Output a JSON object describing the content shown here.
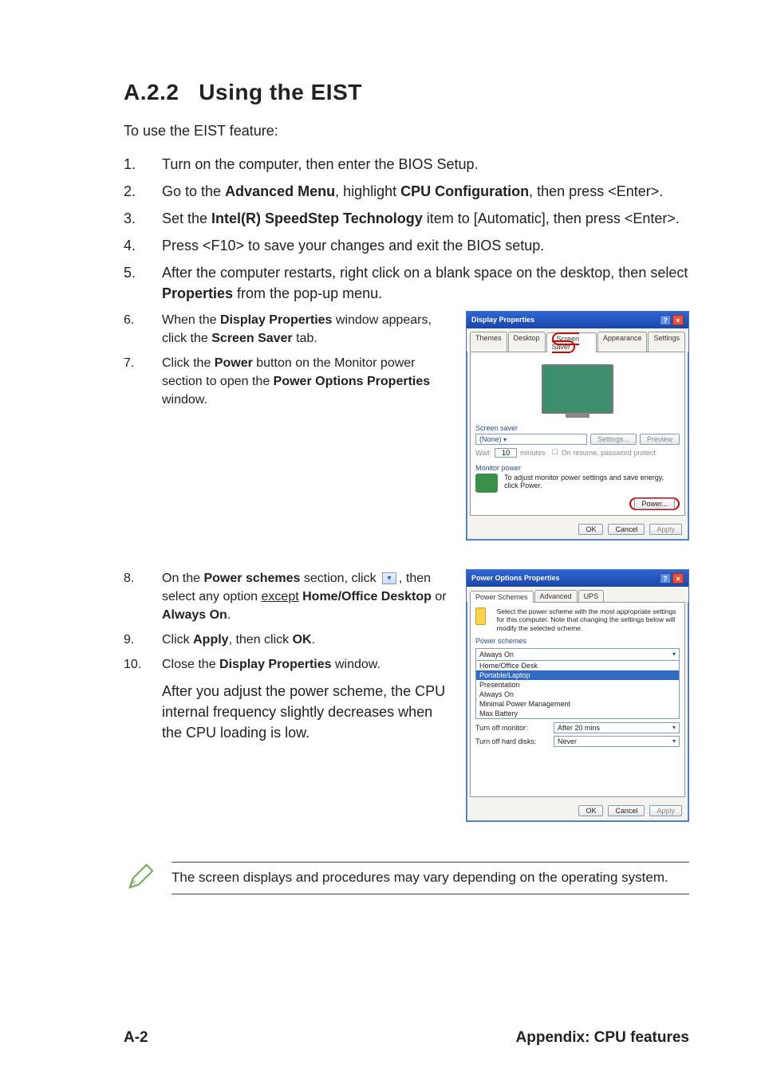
{
  "section": {
    "number": "A.2.2",
    "title": "Using the EIST"
  },
  "intro": "To use the EIST feature:",
  "steps": {
    "s1": "Turn on the computer, then enter the BIOS Setup.",
    "s2a": "Go to the ",
    "s2b": "Advanced Menu",
    "s2c": ", highlight ",
    "s2d": "CPU Configuration",
    "s2e": ", then press <Enter>.",
    "s3a": "Set the ",
    "s3b": "Intel(R) SpeedStep Technology",
    "s3c": " item to [Automatic], then press <Enter>.",
    "s4": "Press <F10> to save your changes and exit the BIOS setup.",
    "s5a": "After the computer restarts, right click on a blank space on the desktop, then select ",
    "s5b": "Properties",
    "s5c": " from the pop-up menu.",
    "s6a": "When the ",
    "s6b": "Display Properties",
    "s6c": " window appears, click the ",
    "s6d": "Screen Saver",
    "s6e": " tab.",
    "s7a": "Click the ",
    "s7b": "Power",
    "s7c": " button on the Monitor power section to open the ",
    "s7d": "Power Options Properties",
    "s7e": " window.",
    "s8a": "On the ",
    "s8b": "Power schemes",
    "s8c": " section, click ",
    "s8d": ", then select any option ",
    "s8e": "except",
    "s8f": " Home/Office Desktop",
    "s8g": " or ",
    "s8h": "Always On",
    "s8i": ".",
    "s9a": "Click ",
    "s9b": "Apply",
    "s9c": ", then click ",
    "s9d": "OK",
    "s9e": ".",
    "s10a": "Close the ",
    "s10b": "Display Properties",
    "s10c": " window."
  },
  "after10": "After you adjust the power scheme, the CPU internal frequency slightly decreases when the CPU loading is low.",
  "note": "The screen displays and procedures may vary depending on the operating system.",
  "footer": {
    "left": "A-2",
    "right": "Appendix: CPU features"
  },
  "display_dialog": {
    "title": "Display Properties",
    "tabs": {
      "themes": "Themes",
      "desktop": "Desktop",
      "screensaver": "Screen Saver",
      "appearance": "Appearance",
      "settings": "Settings"
    },
    "ss_label": "Screen saver",
    "ss_value": "(None)",
    "settings_btn": "Settings...",
    "preview_btn": "Preview",
    "wait_label": "Wait:",
    "wait_value": "10",
    "wait_after": "minutes",
    "resume": "On resume, password protect",
    "mp_label": "Monitor power",
    "mp_text": "To adjust monitor power settings and save energy, click Power.",
    "power_btn": "Power...",
    "ok": "OK",
    "cancel": "Cancel",
    "apply": "Apply"
  },
  "power_dialog": {
    "title": "Power Options Properties",
    "tabs": {
      "schemes": "Power Schemes",
      "advanced": "Advanced",
      "ups": "UPS"
    },
    "desc": "Select the power scheme with the most appropriate settings for this computer. Note that changing the settings below will modify the selected scheme.",
    "ps_label": "Power schemes",
    "selected": "Always On",
    "options": {
      "o1": "Home/Office Desk",
      "o2": "Portable/Laptop",
      "o3": "Presentation",
      "o4": "Always On",
      "o5": "Minimal Power Management",
      "o6": "Max Battery"
    },
    "row_monitor_label": "Turn off monitor:",
    "row_monitor_value": "After 20 mins",
    "row_disks_label": "Turn off hard disks:",
    "row_disks_value": "Never",
    "ok": "OK",
    "cancel": "Cancel",
    "apply": "Apply"
  }
}
